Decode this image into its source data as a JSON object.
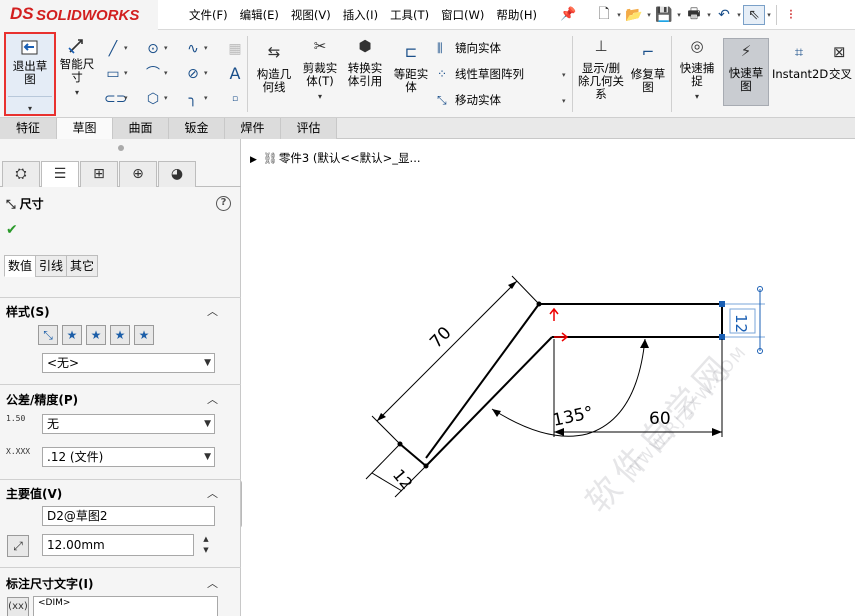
{
  "app": {
    "logo_text": "SOLIDWORKS",
    "logo_mark": "DS"
  },
  "menu": [
    "文件(F)",
    "编辑(E)",
    "视图(V)",
    "插入(I)",
    "工具(T)",
    "窗口(W)",
    "帮助(H)"
  ],
  "ribbon": {
    "exit_sketch": "退出草图",
    "smart_dim": "智能尺寸",
    "construct": "构造几何线",
    "trim": "剪裁实体(T)",
    "convert": "转换实体引用",
    "offset": "等距实体",
    "mirror": "镜向实体",
    "linear_pattern": "线性草图阵列",
    "move": "移动实体",
    "show_delete": "显示/删除几何关系",
    "repair": "修复草图",
    "quick_snap": "快速捕捉",
    "quick_sketch": "快速草图",
    "instant2d": "Instant2D",
    "cross": "交叉"
  },
  "tabs": [
    "特征",
    "草图",
    "曲面",
    "钣金",
    "焊件",
    "评估"
  ],
  "tree": {
    "item": "零件3 (默认<<默认>_显..."
  },
  "panel": {
    "title": "尺寸",
    "subtabs": [
      "数值",
      "引线",
      "其它"
    ],
    "style": {
      "heading": "样式(S)",
      "value": "<无>"
    },
    "tolerance": {
      "heading": "公差/精度(P)",
      "type": "无",
      "precision": ".12 (文件)",
      "ic1": "1.50",
      "ic2": "X.XXX"
    },
    "primary": {
      "heading": "主要值(V)",
      "name": "D2@草图2",
      "value": "12.00mm"
    },
    "dimtext": {
      "heading": "标注尺寸文字(I)",
      "value": "<DIM>"
    }
  },
  "drawing": {
    "dim_70": "70",
    "dim_12a": "12",
    "dim_12b": "12",
    "dim_135": "135°",
    "dim_60": "60"
  },
  "watermark": {
    "big": "软件自学网",
    "small": "WWW.RJZXW.COM"
  }
}
